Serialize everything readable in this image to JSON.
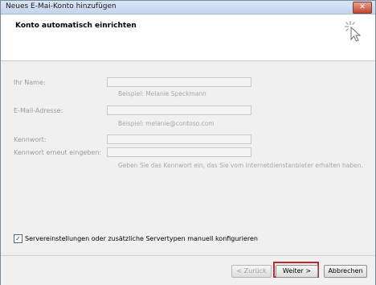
{
  "window": {
    "title": "Neues E-Mai-Konto hinzufügen",
    "close_glyph": "✕"
  },
  "header": {
    "subtitle": "Konto automatisch einrichten"
  },
  "form": {
    "name_label": "Ihr Name:",
    "name_value": "",
    "name_hint": "Beispiel: Melanie Speckmann",
    "email_label": "E-Mail-Adresse:",
    "email_value": "",
    "email_hint": "Beispiel: melanie@contoso.com",
    "password_label": "Kennwort:",
    "password_value": "",
    "password_repeat_label": "Kennwort erneut eingeben:",
    "password_repeat_value": "",
    "password_hint": "Geben Sie das Kennwort ein, das Sie vom Internetdienstanbieter erhalten haben."
  },
  "manual_config": {
    "checked": true,
    "check_glyph": "✓",
    "label": "Servereinstellungen oder zusätzliche Servertypen manuell konfigurieren"
  },
  "buttons": {
    "back": "< Zurück",
    "next": "Weiter >",
    "cancel": "Abbrechen"
  },
  "colors": {
    "highlight": "#c0262c"
  }
}
